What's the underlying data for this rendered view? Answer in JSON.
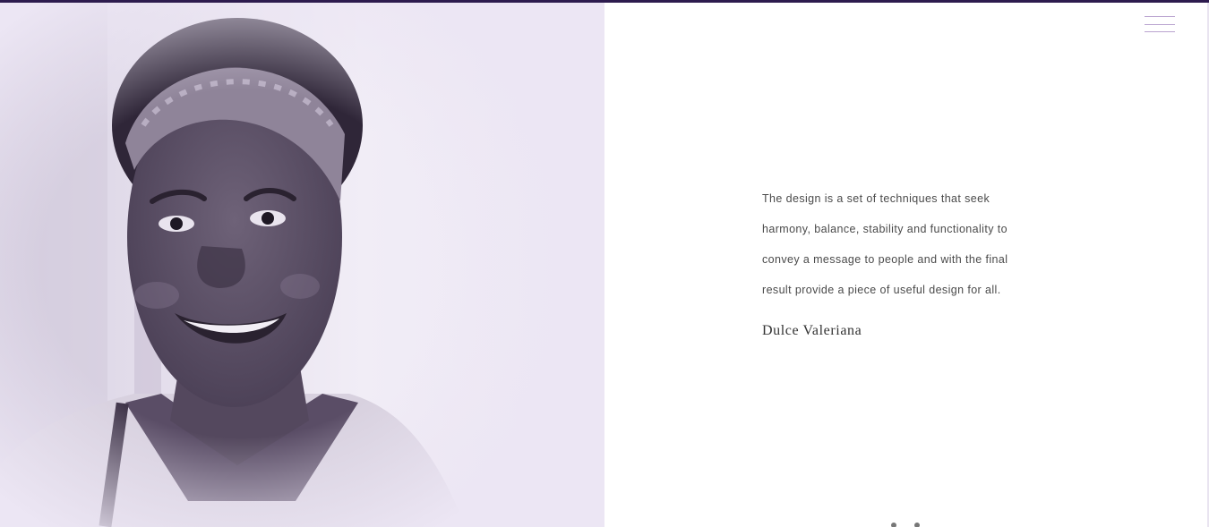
{
  "quote": {
    "lines": [
      "The design is a set of techniques that seek",
      "harmony, balance, stability and functionality to",
      "convey a message to people and with the final",
      "result provide a piece of useful design for all."
    ],
    "author": "Dulce Valeriana"
  },
  "header": {
    "menu_icon": "hamburger-menu-icon"
  },
  "colors": {
    "portrait_background": "#ece6f4",
    "accent_menu": "#b9a3cf",
    "top_strip": "#2d1b4e",
    "text": "#4a4a4a"
  }
}
